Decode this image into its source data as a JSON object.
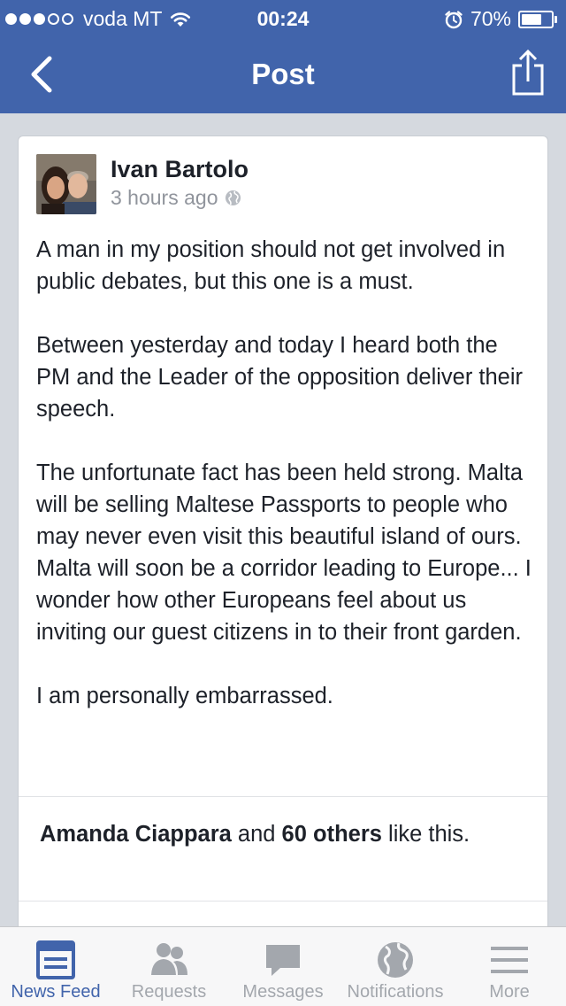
{
  "status_bar": {
    "signal_filled": 3,
    "signal_total": 5,
    "carrier": "voda MT",
    "time": "00:24",
    "battery_percent": "70%",
    "battery_level": 0.7
  },
  "nav": {
    "title": "Post",
    "back_icon": "chevron-left-icon",
    "share_icon": "share-icon"
  },
  "post": {
    "author": "Ivan Bartolo",
    "time_ago": "3 hours ago",
    "privacy_icon": "globe-icon",
    "paragraphs": [
      "A man in my position should not get involved in public debates, but this one is a must.",
      "Between yesterday and today I heard both the PM and the Leader of the opposition deliver their speech.",
      "The unfortunate fact has been held strong. Malta will be selling Maltese Passports to people who may never even visit this beautiful island of ours. Malta will soon be a corridor leading to Europe... I wonder how other Europeans feel about us inviting our guest citizens in to their front garden.",
      "I am personally embarrassed."
    ],
    "likes": {
      "name": "Amanda Ciappara",
      "and": "and",
      "others": "60 others",
      "suffix": "like this."
    }
  },
  "tabbar": {
    "tabs": [
      {
        "label": "News Feed",
        "icon": "news-feed-icon",
        "active": true
      },
      {
        "label": "Requests",
        "icon": "requests-icon",
        "active": false
      },
      {
        "label": "Messages",
        "icon": "messages-icon",
        "active": false
      },
      {
        "label": "Notifications",
        "icon": "globe-icon",
        "active": false
      },
      {
        "label": "More",
        "icon": "menu-icon",
        "active": false
      }
    ]
  },
  "colors": {
    "brand_blue": "#4164ab",
    "background": "#d5d9df",
    "tab_inactive": "#a3a7ad"
  }
}
